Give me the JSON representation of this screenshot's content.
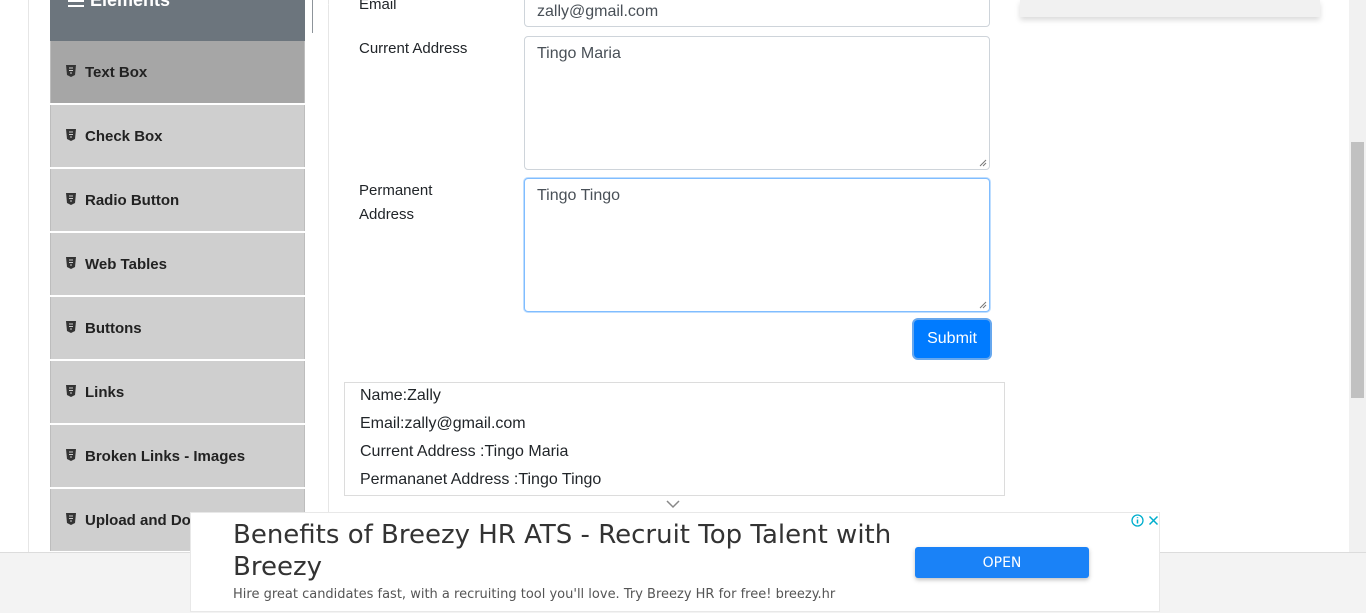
{
  "sidebar": {
    "group_title": "Elements",
    "items": [
      {
        "label": "Text Box",
        "active": true
      },
      {
        "label": "Check Box"
      },
      {
        "label": "Radio Button"
      },
      {
        "label": "Web Tables"
      },
      {
        "label": "Buttons"
      },
      {
        "label": "Links"
      },
      {
        "label": "Broken Links - Images"
      },
      {
        "label": "Upload and Do"
      }
    ]
  },
  "form": {
    "email_label": "Email",
    "email_value": "zally@gmail.com",
    "current_address_label": "Current Address",
    "current_address_value": "Tingo Maria",
    "permanent_address_label_line1": "Permanent",
    "permanent_address_label_line2": "Address",
    "permanent_address_value": "Tingo Tingo",
    "submit_label": "Submit"
  },
  "output": {
    "name": "Name:Zally",
    "email": "Email:zally@gmail.com",
    "current_address": "Current Address :Tingo Maria",
    "permanent_address": "Permananet Address :Tingo Tingo"
  },
  "ad": {
    "headline": "Benefits of Breezy HR ATS - Recruit Top Talent with Breezy",
    "subtext": "Hire great candidates fast, with a recruiting tool you'll love. Try Breezy HR for free! breezy.hr",
    "cta_label": "OPEN"
  },
  "colors": {
    "primary": "#007bff",
    "sidebar_header": "#6c757d",
    "menu_item": "#cfcfcf",
    "menu_item_active": "#a6a6a6"
  }
}
